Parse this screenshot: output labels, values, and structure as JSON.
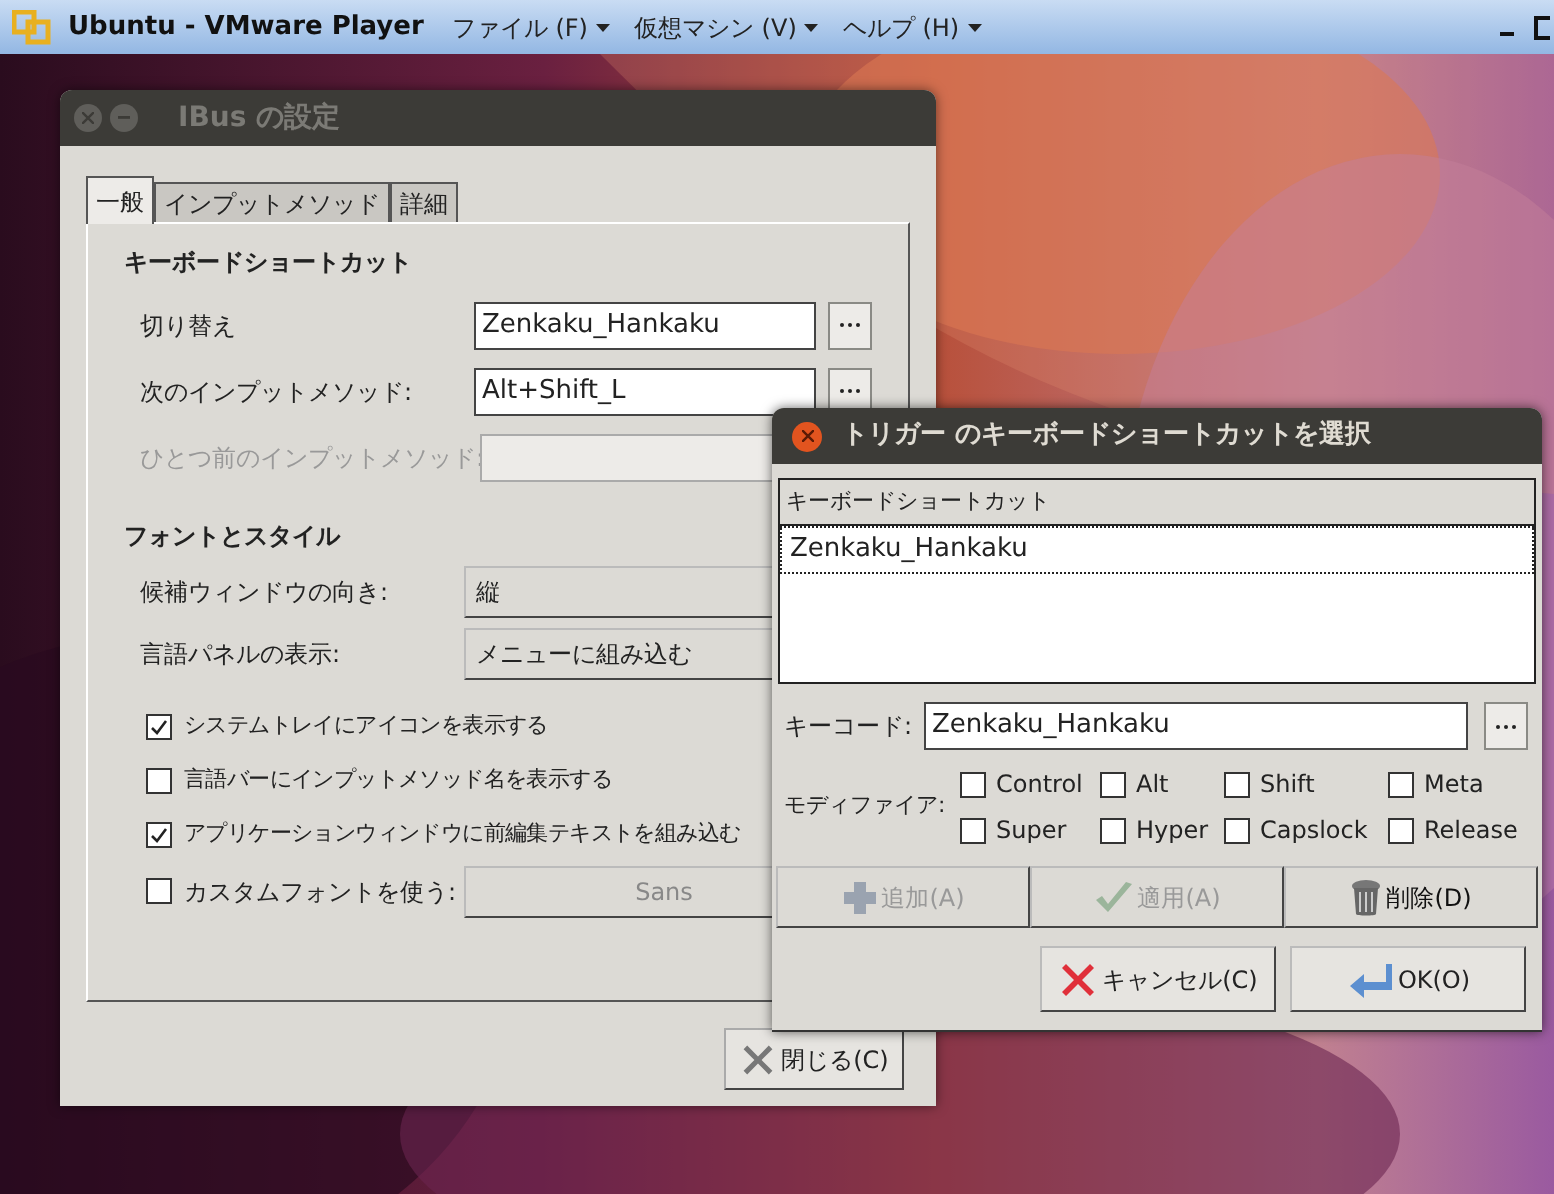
{
  "host_window": {
    "title": "Ubuntu - VMware Player",
    "menus": [
      "ファイル (F)",
      "仮想マシン (V)",
      "ヘルプ (H)"
    ]
  },
  "settings_window": {
    "title": "IBus の設定",
    "tabs": [
      {
        "label": "一般",
        "selected": true
      },
      {
        "label": "インプットメソッド",
        "selected": false
      },
      {
        "label": "詳細",
        "selected": false
      }
    ],
    "shortcut_section": {
      "title": "キーボードショートカット",
      "rows": [
        {
          "label": "切り替え",
          "value": "Zenkaku_Hankaku",
          "disabled": false
        },
        {
          "label": "次のインプットメソッド:",
          "value": "Alt+Shift_L",
          "disabled": false
        },
        {
          "label": "ひとつ前のインプットメソッド:",
          "disabled": true
        }
      ]
    },
    "font_section": {
      "title": "フォントとスタイル",
      "combos": [
        {
          "label": "候補ウィンドウの向き:",
          "value": "縦"
        },
        {
          "label": "言語パネルの表示:",
          "value": "メニューに組み込む"
        }
      ],
      "checks": [
        {
          "label": "システムトレイにアイコンを表示する",
          "checked": true
        },
        {
          "label": "言語バーにインプットメソッド名を表示する",
          "checked": false
        },
        {
          "label": "アプリケーションウィンドウに前編集テキストを組み込む",
          "checked": true
        }
      ],
      "custom_font": {
        "label": "カスタムフォントを使う:",
        "checked": false,
        "font": "Sans"
      }
    },
    "close_button": "閉じる(C)"
  },
  "trigger_dialog": {
    "title": "トリガー のキーボードショートカットを選択",
    "list": {
      "column": "キーボードショートカット",
      "rows": [
        {
          "text": "Zenkaku_Hankaku",
          "selected": true
        }
      ]
    },
    "keycode": {
      "label": "キーコード:",
      "value": "Zenkaku_Hankaku"
    },
    "modifiers": {
      "label": "モディファイア:",
      "items": [
        {
          "label": "Control",
          "checked": false
        },
        {
          "label": "Alt",
          "checked": false
        },
        {
          "label": "Shift",
          "checked": false
        },
        {
          "label": "Meta",
          "checked": false
        },
        {
          "label": "Super",
          "checked": false
        },
        {
          "label": "Hyper",
          "checked": false
        },
        {
          "label": "Capslock",
          "checked": false
        },
        {
          "label": "Release",
          "checked": false
        }
      ]
    },
    "actions": [
      {
        "kind": "add",
        "label": "追加(A)",
        "disabled": true
      },
      {
        "kind": "apply",
        "label": "適用(A)",
        "disabled": true
      },
      {
        "kind": "delete",
        "label": "削除(D)",
        "disabled": false
      }
    ],
    "footer": [
      {
        "kind": "cancel",
        "label": "キャンセル(C)"
      },
      {
        "kind": "ok",
        "label": "OK(O)"
      }
    ]
  }
}
